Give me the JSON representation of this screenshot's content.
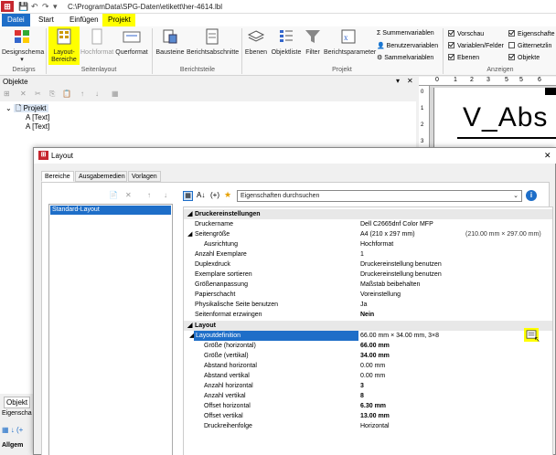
{
  "window": {
    "title_path": "C:\\ProgramData\\SPG-Daten\\etikett\\her-4614.lbl"
  },
  "menu_tabs": [
    "Datei",
    "Start",
    "Einfügen",
    "Projekt"
  ],
  "ribbon": {
    "designs": {
      "button": "Designschema",
      "group": "Designs"
    },
    "seitenlayout": {
      "buttons": [
        "Layout-\nBereiche",
        "Hochformat",
        "Querformat"
      ],
      "group": "Seitenlayout"
    },
    "berichtsteile": {
      "buttons": [
        "Bausteine",
        "Berichtsabschnitte"
      ],
      "group": "Berichtsteile"
    },
    "projekt": {
      "buttons": [
        "Ebenen",
        "Objektliste",
        "Filter",
        "Berichtsparameter"
      ],
      "small_items": [
        "Summenvariablen",
        "Benutzervariablen",
        "Sammelvariablen"
      ],
      "group": "Projekt"
    },
    "anzeigen": {
      "checks": [
        {
          "label": "Vorschau",
          "checked": true
        },
        {
          "label": "Variablen/Felder",
          "checked": true
        },
        {
          "label": "Ebenen",
          "checked": true
        },
        {
          "label": "Eigenschafte",
          "checked": true
        },
        {
          "label": "Gitternetzlin",
          "checked": false
        },
        {
          "label": "Objekte",
          "checked": true
        }
      ],
      "group": "Anzeigen"
    }
  },
  "objects_panel": {
    "title": "Objekte",
    "tree_root": "Projekt",
    "tree_items": [
      "[Text]",
      "[Text]"
    ],
    "item_prefix": "A"
  },
  "preview": {
    "big_text": "V_Abs"
  },
  "bottom_panel": {
    "tab_objekte": "Objekt",
    "tab_eigenschaften": "Eigenscha",
    "allgemein": "Allgem"
  },
  "dialog": {
    "title": "Layout",
    "tabs": [
      "Bereiche",
      "Ausgabemedien",
      "Vorlagen"
    ],
    "list_items": [
      "Standard-Layout"
    ],
    "search_placeholder": "Eigenschaften durchsuchen",
    "categories": {
      "drucker": "Druckereinstellungen",
      "layout": "Layout"
    },
    "properties_drucker": [
      {
        "name": "Druckername",
        "value": "Dell C2665dnf Color MFP",
        "extra": ""
      },
      {
        "name": "Seitengröße",
        "value": "A4 (210 x 297 mm)",
        "extra": "(210.00 mm × 297.00 mm)"
      },
      {
        "name": "Ausrichtung",
        "value": "Hochformat",
        "extra": ""
      },
      {
        "name": "Anzahl Exemplare",
        "value": "1",
        "extra": ""
      },
      {
        "name": "Duplexdruck",
        "value": "Druckereinstellung benutzen",
        "extra": ""
      },
      {
        "name": "Exemplare sortieren",
        "value": "Druckereinstellung benutzen",
        "extra": ""
      },
      {
        "name": "Größenanpassung",
        "value": "Maßstab beibehalten",
        "extra": ""
      },
      {
        "name": "Papierschacht",
        "value": "Voreinstellung",
        "extra": ""
      },
      {
        "name": "Physikalische Seite benutzen",
        "value": "Ja",
        "extra": ""
      },
      {
        "name": "Seitenformat erzwingen",
        "value": "Nein",
        "extra": ""
      }
    ],
    "properties_layout": [
      {
        "name": "Layoutdefinition",
        "value": "66.00 mm × 34.00 mm, 3×8"
      },
      {
        "name": "Größe (horizontal)",
        "value": "66.00 mm"
      },
      {
        "name": "Größe (vertikal)",
        "value": "34.00 mm"
      },
      {
        "name": "Abstand horizontal",
        "value": "0.00 mm"
      },
      {
        "name": "Abstand vertikal",
        "value": "0.00 mm"
      },
      {
        "name": "Anzahl horizontal",
        "value": "3"
      },
      {
        "name": "Anzahl vertikal",
        "value": "8"
      },
      {
        "name": "Offset horizontal",
        "value": "6.30 mm"
      },
      {
        "name": "Offset vertikal",
        "value": "13.00 mm"
      },
      {
        "name": "Druckreihenfolge",
        "value": "Horizontal"
      }
    ]
  },
  "colors": {
    "accent": "#1e6ec8",
    "highlight": "#ffff00",
    "logo": "#c6262e"
  }
}
